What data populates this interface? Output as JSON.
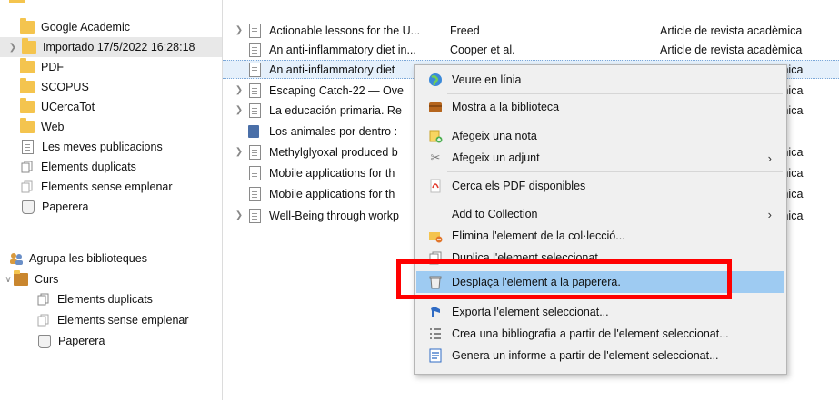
{
  "sidebar": {
    "items": [
      {
        "label": "Google Academic",
        "icon": "folder-icon"
      },
      {
        "label": "Importado 17/5/2022 16:28:18",
        "icon": "folder-icon"
      },
      {
        "label": "PDF",
        "icon": "folder-icon"
      },
      {
        "label": "SCOPUS",
        "icon": "folder-icon"
      },
      {
        "label": "UCercaTot",
        "icon": "folder-icon"
      },
      {
        "label": "Web",
        "icon": "folder-icon"
      },
      {
        "label": "Les meves publicacions",
        "icon": "document-icon"
      },
      {
        "label": "Elements duplicats",
        "icon": "duplicate-icon"
      },
      {
        "label": "Elements sense emplenar",
        "icon": "unfiled-icon"
      },
      {
        "label": "Paperera",
        "icon": "trash-icon"
      }
    ],
    "group_header": "Agrupa les biblioteques",
    "curs": {
      "label": "Curs",
      "children": [
        {
          "label": "Elements duplicats"
        },
        {
          "label": "Elements sense emplenar"
        },
        {
          "label": "Paperera"
        }
      ]
    }
  },
  "items": [
    {
      "title": "Actionable lessons for the U...",
      "creator": "Freed",
      "type": "Article de revista acadèmica"
    },
    {
      "title": "An anti-inflammatory diet in...",
      "creator": "Cooper et al.",
      "type": "Article de revista acadèmica"
    },
    {
      "title": "An anti-inflammatory diet",
      "creator": "",
      "type": "mica"
    },
    {
      "title": "Escaping Catch-22 — Ove",
      "creator": "",
      "type": "mica"
    },
    {
      "title": "La educación primaria. Re",
      "creator": "",
      "type": "mica"
    },
    {
      "title": "Los animales por dentro :",
      "creator": "",
      "type": ""
    },
    {
      "title": "Methylglyoxal produced b",
      "creator": "",
      "type": "mica"
    },
    {
      "title": "Mobile applications for th",
      "creator": "",
      "type": "mica"
    },
    {
      "title": "Mobile applications for th",
      "creator": "",
      "type": "mica"
    },
    {
      "title": "Well-Being through workp",
      "creator": "",
      "type": "mica"
    }
  ],
  "context_menu": {
    "view_online": "Veure en línia",
    "show_in_library": "Mostra a la biblioteca",
    "add_note": "Afegeix una nota",
    "add_attachment": "Afegeix un adjunt",
    "find_pdfs": "Cerca els PDF disponibles",
    "add_to_collection": "Add to Collection",
    "remove_from_collection": "Elimina l'element de la col·lecció...",
    "duplicate": "Duplica l'element seleccionat",
    "move_to_trash": "Desplaça l'element a la paperera.",
    "export": "Exporta l'element seleccionat...",
    "create_bibliography": "Crea una bibliografia a partir de l'element seleccionat...",
    "generate_report": "Genera un informe a partir de l'element seleccionat..."
  },
  "colors": {
    "folder": "#f4c44e",
    "highlight": "#9ecbf2",
    "annotation_red": "#ff0000",
    "selection": "#e5f0fb"
  }
}
